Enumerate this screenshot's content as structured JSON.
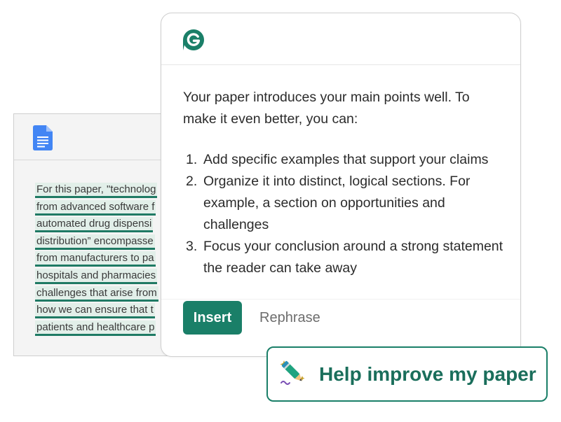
{
  "colors": {
    "brand_green": "#1a7f68",
    "highlight_bg": "#e2efe9",
    "underline": "#1f7a64",
    "docs_blue": "#4285f4"
  },
  "document": {
    "icon": "google-docs-icon",
    "lines": [
      "For this paper, \"technolog",
      "from advanced software f",
      "automated drug dispensi",
      "distribution” encompasse",
      "from manufacturers to pa",
      "hospitals and pharmacies",
      "challenges that arise from",
      "how we can ensure that t",
      "patients and healthcare p"
    ]
  },
  "assistant": {
    "logo": "grammarly-g-icon",
    "intro": "Your paper introduces your main points well. To make it even better, you can:",
    "points": [
      {
        "num": "1.",
        "text": "Add specific examples that support your claims"
      },
      {
        "num": "2.",
        "text": "Organize it into distinct, logical sections. For example, a section on opportunities and challenges"
      },
      {
        "num": "3.",
        "text": "Focus your conclusion around a strong statement the reader can take away"
      }
    ],
    "insert_label": "Insert",
    "rephrase_label": "Rephrase"
  },
  "prompt_chip": {
    "icon": "pencil-sparkle-icon",
    "label": "Help improve my paper"
  }
}
